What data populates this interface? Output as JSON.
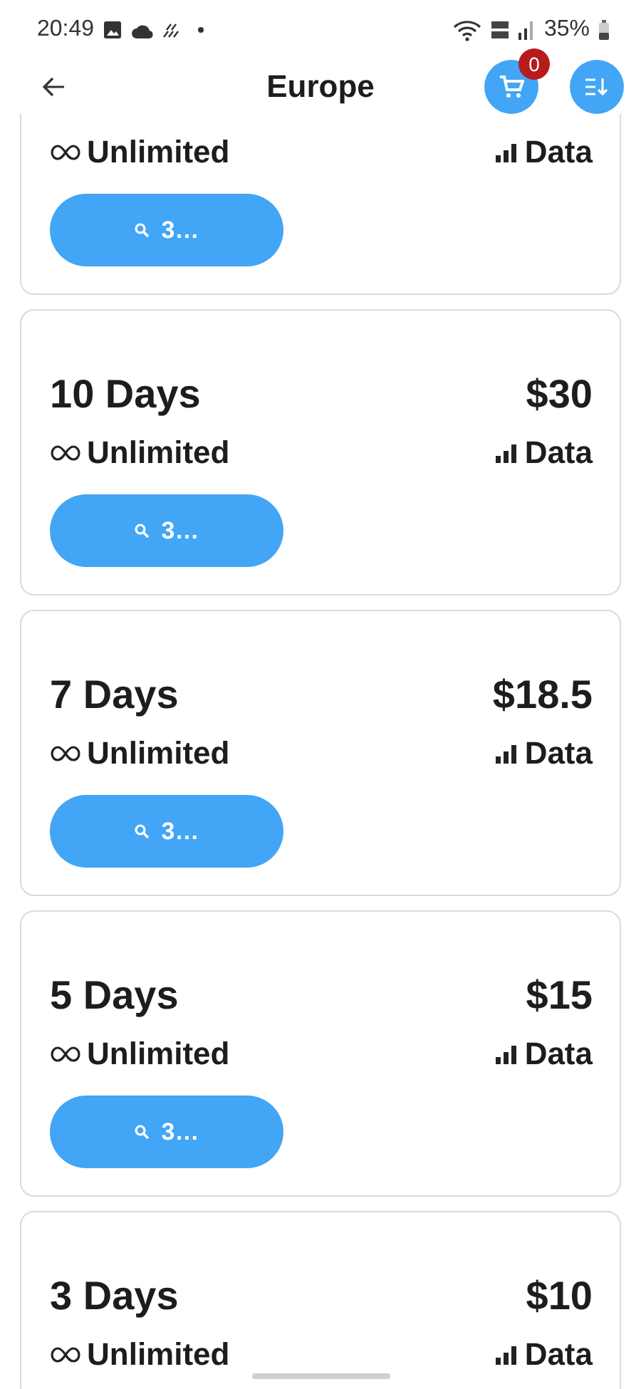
{
  "status_bar": {
    "time": "20:49",
    "battery": "35%"
  },
  "header": {
    "title": "Europe",
    "cart_count": "0"
  },
  "plans": [
    {
      "allowance": "Unlimited",
      "type": "Data",
      "button": "3…"
    },
    {
      "days": "10 Days",
      "price": "$30",
      "allowance": "Unlimited",
      "type": "Data",
      "button": "3…"
    },
    {
      "days": "7 Days",
      "price": "$18.5",
      "allowance": "Unlimited",
      "type": "Data",
      "button": "3…"
    },
    {
      "days": "5 Days",
      "price": "$15",
      "allowance": "Unlimited",
      "type": "Data",
      "button": "3…"
    },
    {
      "days": "3 Days",
      "price": "$10",
      "allowance": "Unlimited",
      "type": "Data"
    }
  ]
}
